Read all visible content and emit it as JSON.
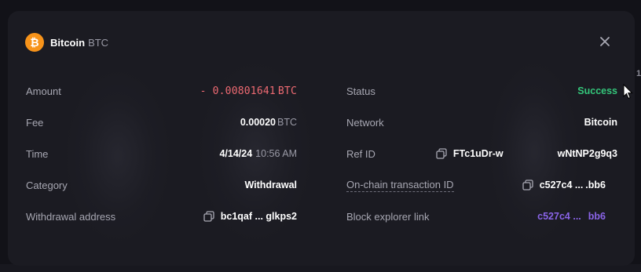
{
  "header": {
    "coin_symbol": "₿",
    "coin_name": "Bitcoin",
    "coin_ticker": "BTC",
    "close_icon": "close-icon"
  },
  "left": {
    "amount": {
      "label": "Amount",
      "value": "- 0.00801641",
      "unit": "BTC"
    },
    "fee": {
      "label": "Fee",
      "value": "0.00020",
      "unit": "BTC"
    },
    "time": {
      "label": "Time",
      "value": "4/14/24",
      "time": "10:56 AM"
    },
    "category": {
      "label": "Category",
      "value": "Withdrawal"
    },
    "withdrawal_address": {
      "label": "Withdrawal address",
      "value": "bc1qaf ... glkps2"
    }
  },
  "right": {
    "status": {
      "label": "Status",
      "value": "Success"
    },
    "network": {
      "label": "Network",
      "value": "Bitcoin"
    },
    "ref_id": {
      "label": "Ref ID",
      "value_start": "FTc1uDr-w",
      "value_end": "wNtNP2g9q3"
    },
    "onchain_tx": {
      "label": "On-chain transaction ID",
      "value_start": "c527c4 ...",
      "value_end": ".bb6"
    },
    "block_explorer": {
      "label": "Block explorer link",
      "value_start": "c527c4 ...",
      "value_end": "bb6"
    }
  },
  "colors": {
    "negative": "#ee6a72",
    "success": "#34c77b",
    "link": "#8a64e8",
    "bitcoin": "#f7931a"
  }
}
